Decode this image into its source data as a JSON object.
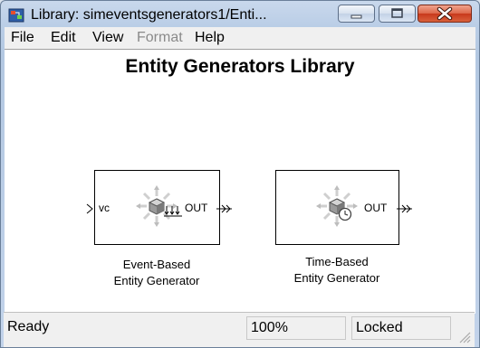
{
  "window": {
    "title": "Library: simeventsgenerators1/Enti..."
  },
  "menu": {
    "items": [
      {
        "label": "File",
        "enabled": true
      },
      {
        "label": "Edit",
        "enabled": true
      },
      {
        "label": "View",
        "enabled": true
      },
      {
        "label": "Format",
        "enabled": false
      },
      {
        "label": "Help",
        "enabled": true
      }
    ]
  },
  "library": {
    "title": "Entity Generators Library",
    "blocks": [
      {
        "label_line1": "Event-Based",
        "label_line2": "Entity Generator",
        "input_port": "vc",
        "output_port": "OUT"
      },
      {
        "label_line1": "Time-Based",
        "label_line2": "Entity Generator",
        "output_port": "OUT"
      }
    ]
  },
  "status": {
    "text": "Ready",
    "zoom": "100%",
    "lock_state": "Locked"
  }
}
